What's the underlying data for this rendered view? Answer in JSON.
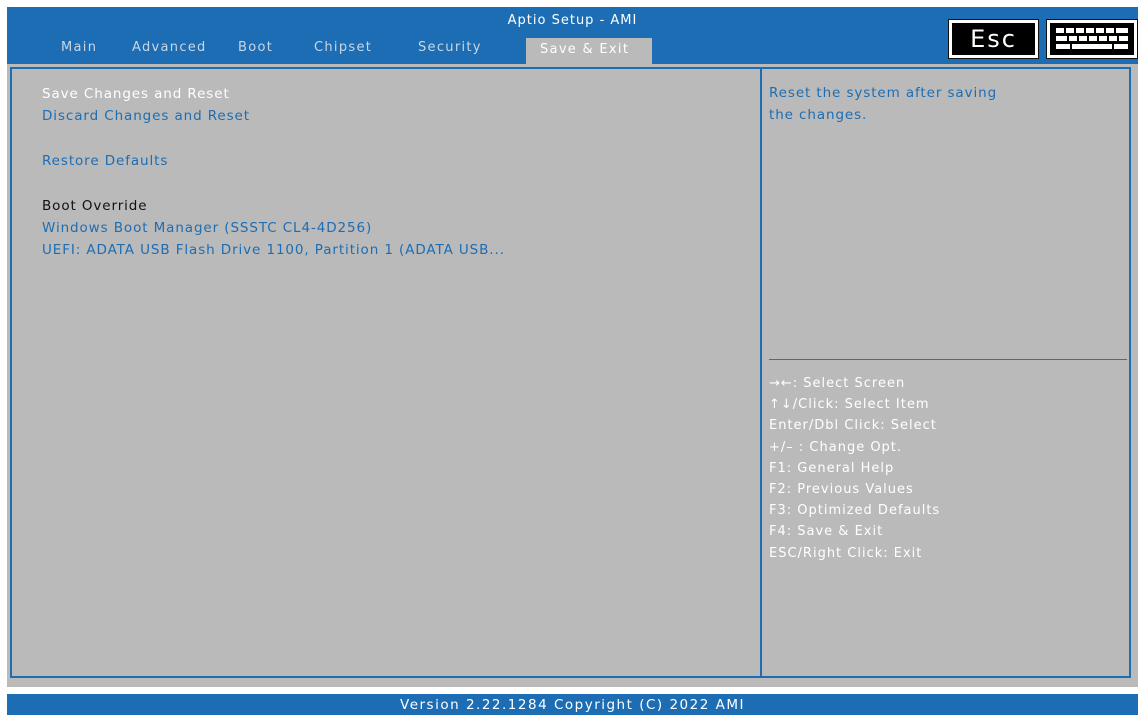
{
  "header": {
    "title": "Aptio Setup - AMI",
    "tabs": [
      {
        "label": "Main"
      },
      {
        "label": "Advanced"
      },
      {
        "label": "Boot"
      },
      {
        "label": "Chipset"
      },
      {
        "label": "Security"
      },
      {
        "label": "Save & Exit"
      }
    ],
    "active_tab": "Save & Exit",
    "esc_key_label": "Esc",
    "keyboard_icon": "keyboard-icon"
  },
  "menu": {
    "items": [
      {
        "label": "Save Changes and Reset"
      },
      {
        "label": "Discard Changes and Reset"
      },
      {
        "label": "Restore Defaults"
      }
    ],
    "boot_override_heading": "Boot Override",
    "boot_devices": [
      {
        "label": "Windows Boot Manager (SSSTC CL4-4D256)"
      },
      {
        "label": "UEFI: ADATA USB Flash Drive 1100, Partition 1 (ADATA USB..."
      }
    ]
  },
  "help": {
    "line1": "Reset the system after saving",
    "line2": "the changes."
  },
  "key_legend": [
    "→←: Select Screen",
    "↑↓/Click: Select Item",
    "Enter/Dbl Click: Select",
    "+/– : Change Opt.",
    "F1: General Help",
    "F2: Previous Values",
    "F3: Optimized Defaults",
    "F4: Save & Exit",
    "ESC/Right Click: Exit"
  ],
  "footer": {
    "version": "Version 2.22.1284 Copyright (C) 2022 AMI"
  },
  "colors": {
    "accent_blue": "#1d6db4",
    "panel_gray": "#bababa",
    "selected_text": "#ffffff"
  }
}
